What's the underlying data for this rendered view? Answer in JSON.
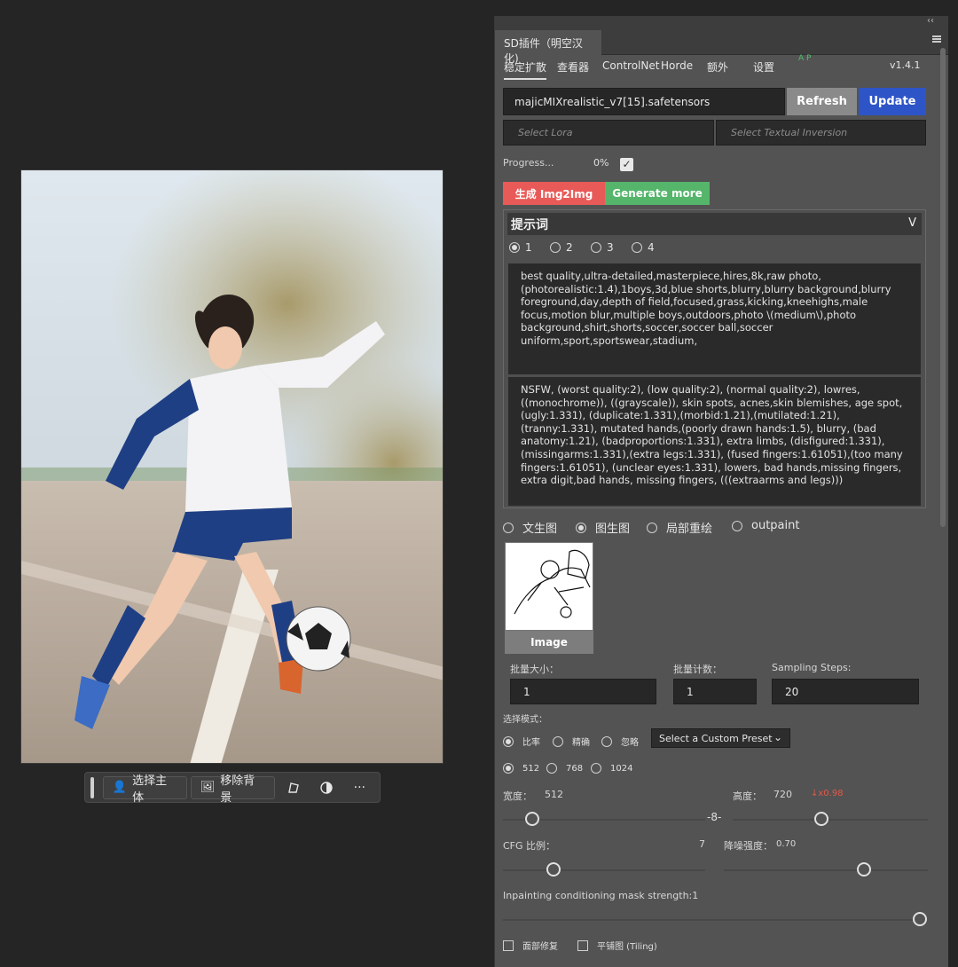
{
  "canvas": {
    "toolbar": {
      "select_subject": "选择主体",
      "remove_background": "移除背景",
      "more": "···"
    }
  },
  "plugin": {
    "tab_title": "SD插件（明空汉化)",
    "collapse": "‹‹",
    "nav": {
      "stable_diffusion": "稳定扩散",
      "viewer": "查看器",
      "controlnet": "ControlNet",
      "horde": "Horde",
      "extras": "额外",
      "settings": "设置",
      "ap": "A P",
      "version": "v1.4.1"
    },
    "model": "majicMIXrealistic_v7[15].safetensors",
    "refresh_label": "Refresh",
    "update_label": "Update",
    "lora_placeholder": "Select Lora",
    "ti_placeholder": "Select Textual Inversion",
    "progress_label": "Progress...",
    "progress_value": "0%",
    "progress_checked": true,
    "generate_label": "生成 Img2Img",
    "generate_more_label": "Generate more",
    "prompt": {
      "header": "提示词",
      "toggle": "V",
      "slots": [
        "1",
        "2",
        "3",
        "4"
      ],
      "selected_slot": 0,
      "positive": "best quality,ultra-detailed,masterpiece,hires,8k,raw photo,(photorealistic:1.4),1boys,3d,blue shorts,blurry,blurry background,blurry foreground,day,depth of field,focused,grass,kicking,kneehighs,male focus,motion blur,multiple boys,outdoors,photo \\(medium\\),photo background,shirt,shorts,soccer,soccer ball,soccer uniform,sport,sportswear,stadium,",
      "negative": "NSFW, (worst quality:2), (low quality:2), (normal quality:2), lowres, ((monochrome)), ((grayscale)), skin spots, acnes,skin blemishes, age spot, (ugly:1.331), (duplicate:1.331),(morbid:1.21),(mutilated:1.21), (tranny:1.331), mutated hands,(poorly drawn hands:1.5), blurry, (bad anatomy:1.21), (badproportions:1.331), extra limbs, (disfigured:1.331), (missingarms:1.331),(extra legs:1.331), (fused fingers:1.61051),(too many fingers:1.61051), (unclear eyes:1.331), lowers, bad hands,missing fingers, extra digit,bad hands, missing fingers, (((extraarms and legs)))"
    },
    "modes": [
      "文生图",
      "图生图",
      "局部重绘",
      "outpaint"
    ],
    "selected_mode": 1,
    "image_caption": "Image",
    "batch_size_label": "批量大小：",
    "batch_size": "1",
    "batch_count_label": "批量计数：",
    "batch_count": "1",
    "steps_label": "Sampling Steps:",
    "steps": "20",
    "select_mode_label": "选择模式：",
    "scale_modes": [
      "比率",
      "精确",
      "忽略"
    ],
    "selected_scale_mode": 0,
    "preset_label": "Select a Custom Preset",
    "sizes": [
      "512",
      "768",
      "1024"
    ],
    "selected_size": 0,
    "width_label": "宽度：",
    "width": "512",
    "height_label": "高度：",
    "height": "720",
    "ratio": "↓x0.98",
    "cfg_label": "CFG 比例：",
    "cfg": "7",
    "denoise_label": "降噪强度：",
    "denoise": "0.70",
    "mask_label": "Inpainting conditioning mask strength:1",
    "face_restore": "面部修复",
    "tiling": "平铺图 (Tiling)",
    "sliders": {
      "width_pos": 0.12,
      "height_pos": 0.45,
      "cfg_pos": 0.23,
      "denoise_pos": 0.7,
      "mask_pos": 1.0
    },
    "colors": {
      "generate": "#e85a58",
      "generate_more": "#55b56b",
      "update": "#2e55c8",
      "panel": "#535353"
    }
  }
}
